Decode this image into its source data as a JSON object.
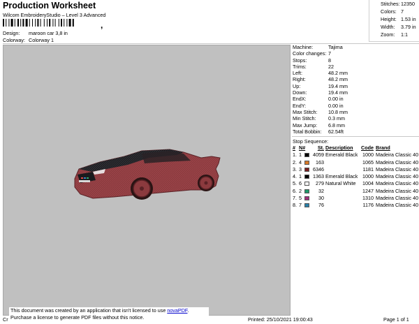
{
  "header": {
    "title": "Production Worksheet",
    "subtitle": "Wilcom EmbroideryStudio – Level 3 Advanced"
  },
  "design": {
    "label": "Design:",
    "value": "maroon car 3,8 in"
  },
  "colorway": {
    "label": "Colorway:",
    "value": "Colorway 1"
  },
  "stats": [
    {
      "label": "Stitches:",
      "value": "12350"
    },
    {
      "label": "Colors:",
      "value": "7"
    },
    {
      "label": "Height:",
      "value": "1.53 in"
    },
    {
      "label": "Width:",
      "value": "3.79 in"
    },
    {
      "label": "Zoom:",
      "value": "1:1"
    }
  ],
  "machine_info": [
    {
      "label": "Machine:",
      "value": "Tajima"
    },
    {
      "label": "Color changes:",
      "value": "7"
    },
    {
      "label": "Stops:",
      "value": "8"
    },
    {
      "label": "Trims:",
      "value": "22"
    },
    {
      "label": "Left:",
      "value": "48.2 mm"
    },
    {
      "label": "Right:",
      "value": "48.2 mm"
    },
    {
      "label": "Up:",
      "value": "19.4 mm"
    },
    {
      "label": "Down:",
      "value": "19.4 mm"
    },
    {
      "label": "EndX:",
      "value": "0.00 in"
    },
    {
      "label": "EndY:",
      "value": "0.00 in"
    },
    {
      "label": "Max Stitch:",
      "value": "10.8 mm"
    },
    {
      "label": "Min Stitch:",
      "value": "0.3 mm"
    },
    {
      "label": "Max Jump:",
      "value": "6.8 mm"
    },
    {
      "label": "Total Bobbin:",
      "value": "62.54ft"
    }
  ],
  "stop_sequence": {
    "title": "Stop Sequence:",
    "headers": {
      "num": "#",
      "n": "N#",
      "st": "St.",
      "desc": "Description",
      "code": "Code",
      "brand": "Brand"
    },
    "rows": [
      {
        "num": "1.",
        "n": "1",
        "color": "#000000",
        "st": "4059",
        "desc": "Emerald Black",
        "code": "1000",
        "brand": "Madeira Classic 40"
      },
      {
        "num": "2.",
        "n": "4",
        "color": "#d97a28",
        "st": "163",
        "desc": "",
        "code": "1065",
        "brand": "Madeira Classic 40"
      },
      {
        "num": "3.",
        "n": "3",
        "color": "#7a1e20",
        "st": "6346",
        "desc": "",
        "code": "1181",
        "brand": "Madeira Classic 40"
      },
      {
        "num": "4.",
        "n": "1",
        "color": "#000000",
        "st": "1363",
        "desc": "Emerald Black",
        "code": "1000",
        "brand": "Madeira Classic 40"
      },
      {
        "num": "5.",
        "n": "6",
        "color": "#f2f2f2",
        "st": "279",
        "desc": "Natural White",
        "code": "1004",
        "brand": "Madeira Classic 40"
      },
      {
        "num": "6.",
        "n": "2",
        "color": "#1f9a6a",
        "st": "32",
        "desc": "",
        "code": "1247",
        "brand": "Madeira Classic 40"
      },
      {
        "num": "7.",
        "n": "5",
        "color": "#a0307a",
        "st": "30",
        "desc": "",
        "code": "1310",
        "brand": "Madeira Classic 40"
      },
      {
        "num": "8.",
        "n": "7",
        "color": "#2a7fa8",
        "st": "76",
        "desc": "",
        "code": "1176",
        "brand": "Madeira Classic 40"
      }
    ]
  },
  "notice": {
    "line1_pre": "This document was created by an application that isn't licensed to use ",
    "link": "novaPDF",
    "line1_post": ".",
    "line2": "Purchase a license to generate PDF files without this notice."
  },
  "footer": {
    "left": "Cr",
    "printed": "Printed: 25/10/2021 19:00:43",
    "page": "Page 1 of 1"
  },
  "colors": {
    "canvas_bg": "#c0c0c0",
    "car_body": "#8b3a3e",
    "car_hood": "#1e1e22"
  }
}
